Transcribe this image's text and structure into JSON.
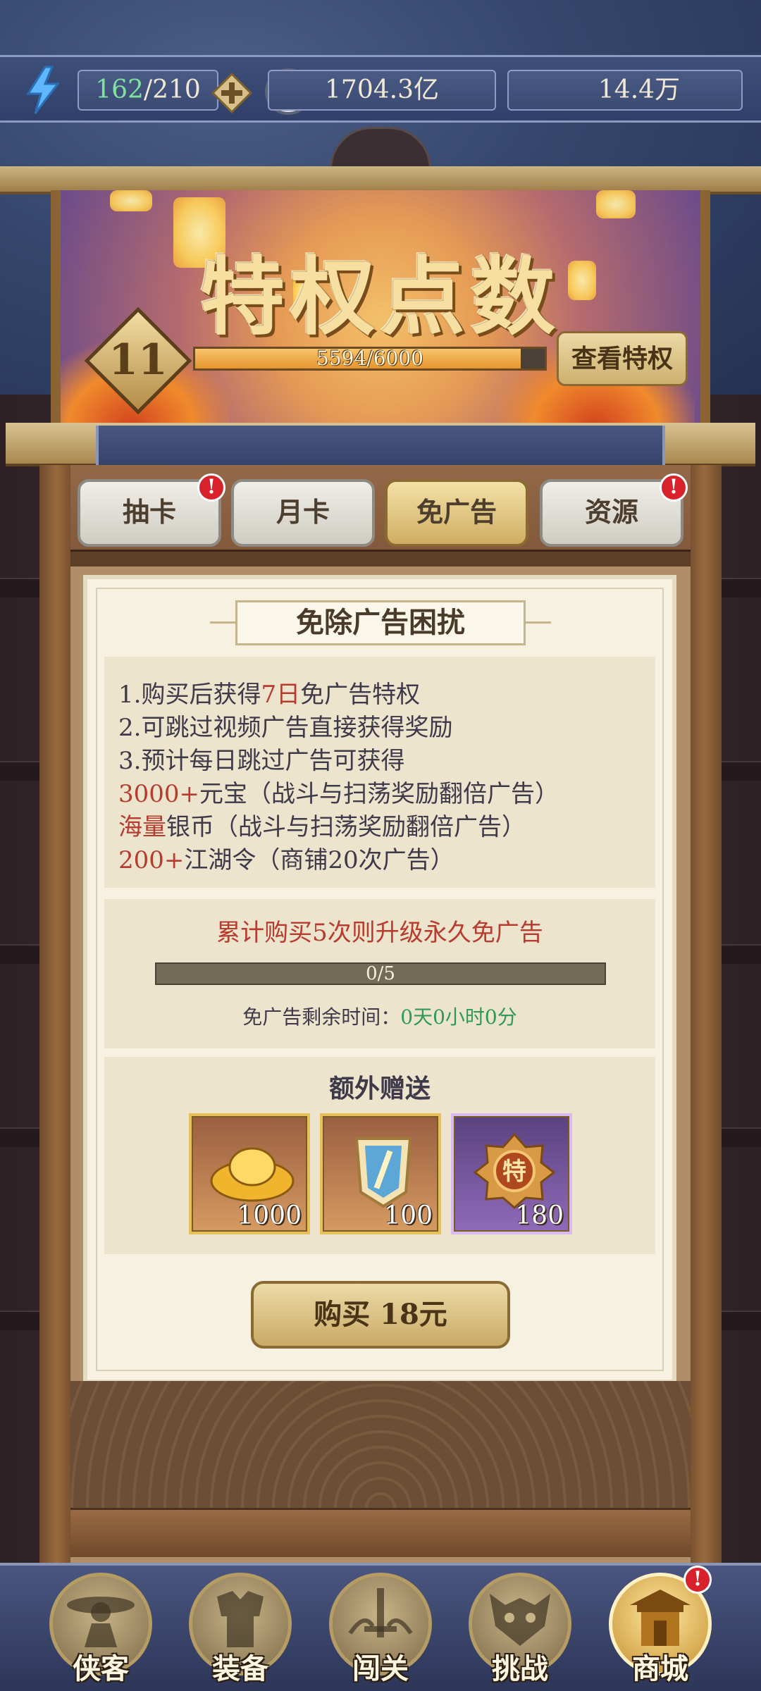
{
  "resources": {
    "energy_current": "162",
    "energy_max": "/210",
    "silver": "1704.3亿",
    "gold": "14.4万"
  },
  "banner": {
    "title": "特权点数",
    "level": "11",
    "progress_text": "5594/6000",
    "progress_fraction": 0.932,
    "view_button": "查看特权"
  },
  "tabs": [
    {
      "label": "抽卡",
      "badge": "!"
    },
    {
      "label": "月卡",
      "badge": ""
    },
    {
      "label": "免广告",
      "badge": ""
    },
    {
      "label": "资源",
      "badge": "!"
    }
  ],
  "content": {
    "heading": "免除广告困扰",
    "line1": {
      "a": "1.购买后获得",
      "b": "7日",
      "c": "免广告特权"
    },
    "line2": "2.可跳过视频广告直接获得奖励",
    "line3": "3.预计每日跳过广告可获得",
    "line4": {
      "a": "3000+",
      "b": "元宝（战斗与扫荡奖励翻倍广告）"
    },
    "line5": {
      "a": "海量",
      "b": "银币（战斗与扫荡奖励翻倍广告）"
    },
    "line6": {
      "a": "200+",
      "b": "江湖令（商铺20次广告）"
    },
    "upgrade_text": "累计购买5次则升级永久免广告",
    "purchase_progress": "0/5",
    "remaining_label": "免广告剩余时间：",
    "remaining_value": "0天0小时0分",
    "bonus_title": "额外赠送",
    "items": [
      {
        "icon": "gold-ingot-icon",
        "count": "1000"
      },
      {
        "icon": "token-shield-icon",
        "count": "100"
      },
      {
        "icon": "privilege-medal-icon",
        "count": "180"
      }
    ],
    "buy_button": "购买 18元"
  },
  "nav": [
    {
      "label": "侠客",
      "icon": "hero-icon"
    },
    {
      "label": "装备",
      "icon": "armor-icon"
    },
    {
      "label": "闯关",
      "icon": "sword-icon"
    },
    {
      "label": "挑战",
      "icon": "demon-mask-icon"
    },
    {
      "label": "商城",
      "icon": "shop-icon",
      "badge": "!"
    }
  ],
  "colors": {
    "accent_red": "#b73b2e",
    "energy_green": "#7ee2a0",
    "remaining_green": "#2f9a55",
    "gold": "#e6c05a"
  }
}
